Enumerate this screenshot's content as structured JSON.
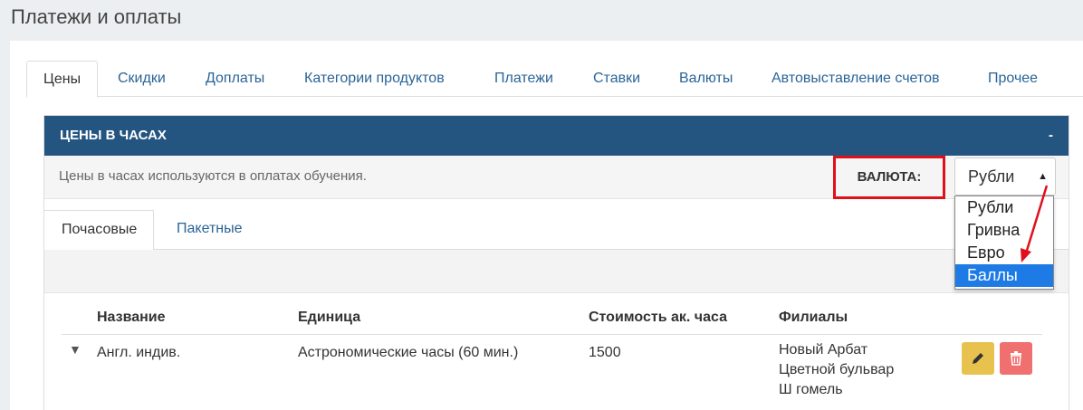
{
  "page": {
    "title": "Платежи и оплаты"
  },
  "tabs": [
    {
      "label": "Цены",
      "active": true
    },
    {
      "label": "Скидки"
    },
    {
      "label": "Доплаты"
    },
    {
      "label": "Категории продуктов"
    },
    {
      "label": "Платежи"
    },
    {
      "label": "Ставки"
    },
    {
      "label": "Валюты"
    },
    {
      "label": "Автовыставление счетов"
    },
    {
      "label": "Прочее"
    }
  ],
  "panel": {
    "title": "ЦЕНЫ В ЧАСАХ",
    "collapse_label": "-",
    "info_text": "Цены в часах используются в оплатах обучения.",
    "currency_label": "ВАЛЮТА:",
    "currency_selected": "Рубли",
    "currency_options": [
      "Рубли",
      "Гривна",
      "Евро",
      "Баллы"
    ],
    "highlighted_option": "Баллы"
  },
  "subtabs": [
    {
      "label": "Почасовые",
      "active": true
    },
    {
      "label": "Пакетные"
    }
  ],
  "table": {
    "headers": [
      "Название",
      "Единица",
      "Стоимость ак. часа",
      "Филиалы"
    ],
    "rows": [
      {
        "name": "Англ. индив.",
        "unit": "Астрономические часы (60 мин.)",
        "cost": "1500",
        "branches": [
          "Новый Арбат",
          "Цветной бульвар",
          "Ш гомель"
        ]
      }
    ]
  },
  "colors": {
    "header_bg": "#245580",
    "link": "#2a6496",
    "highlight_box": "#e0101a",
    "edit_btn": "#e8c24f",
    "delete_btn": "#f07070",
    "option_highlight": "#1e7be5"
  },
  "icons": {
    "expand": "triangle-down-icon",
    "edit": "pencil-icon",
    "delete": "trash-icon",
    "select": "updown-caret-icon"
  }
}
